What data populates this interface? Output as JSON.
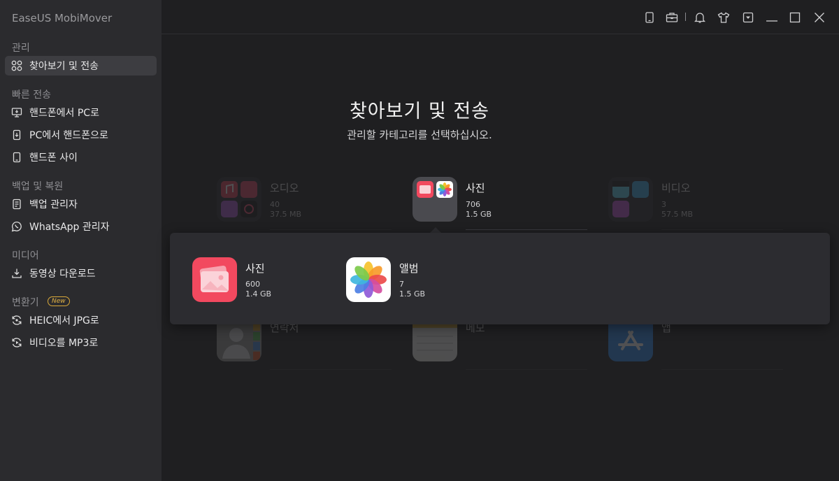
{
  "app": {
    "title": "EaseUS MobiMover"
  },
  "sidebar": {
    "sections": [
      {
        "label": "관리"
      },
      {
        "label": "빠른 전송"
      },
      {
        "label": "백업 및 복원"
      },
      {
        "label": "미디어"
      },
      {
        "label": "변환기"
      }
    ],
    "new_badge": "New",
    "items": [
      {
        "label": "찾아보기 및 전송",
        "icon": "grid-icon"
      },
      {
        "label": "핸드폰에서 PC로",
        "icon": "phone-to-pc-icon"
      },
      {
        "label": "PC에서 핸드폰으로",
        "icon": "pc-to-phone-icon"
      },
      {
        "label": "핸드폰 사이",
        "icon": "phone-to-phone-icon"
      },
      {
        "label": "백업 관리자",
        "icon": "backup-icon"
      },
      {
        "label": "WhatsApp 관리자",
        "icon": "whatsapp-icon"
      },
      {
        "label": "동영상 다운로드",
        "icon": "download-icon"
      },
      {
        "label": "HEIC에서 JPG로",
        "icon": "heic-convert-icon"
      },
      {
        "label": "비디오를 MP3로",
        "icon": "video-to-mp3-icon"
      }
    ]
  },
  "main": {
    "title": "찾아보기 및 전송",
    "subtitle": "관리할 카테고리를 선택하십시오."
  },
  "categories": [
    {
      "name": "오디오",
      "count": "40",
      "size": "37.5 MB"
    },
    {
      "name": "사진",
      "count": "706",
      "size": "1.5 GB"
    },
    {
      "name": "비디오",
      "count": "3",
      "size": "57.5 MB"
    },
    {
      "name": "연락처"
    },
    {
      "name": "메모"
    },
    {
      "name": "앱"
    }
  ],
  "photo_popup": {
    "items": [
      {
        "name": "사진",
        "count": "600",
        "size": "1.4 GB"
      },
      {
        "name": "앨범",
        "count": "7",
        "size": "1.5 GB"
      }
    ]
  },
  "colors": {
    "accent": "#d9a93a",
    "sidebar_bg": "#2b2b2e",
    "main_bg": "#1f1f21"
  }
}
